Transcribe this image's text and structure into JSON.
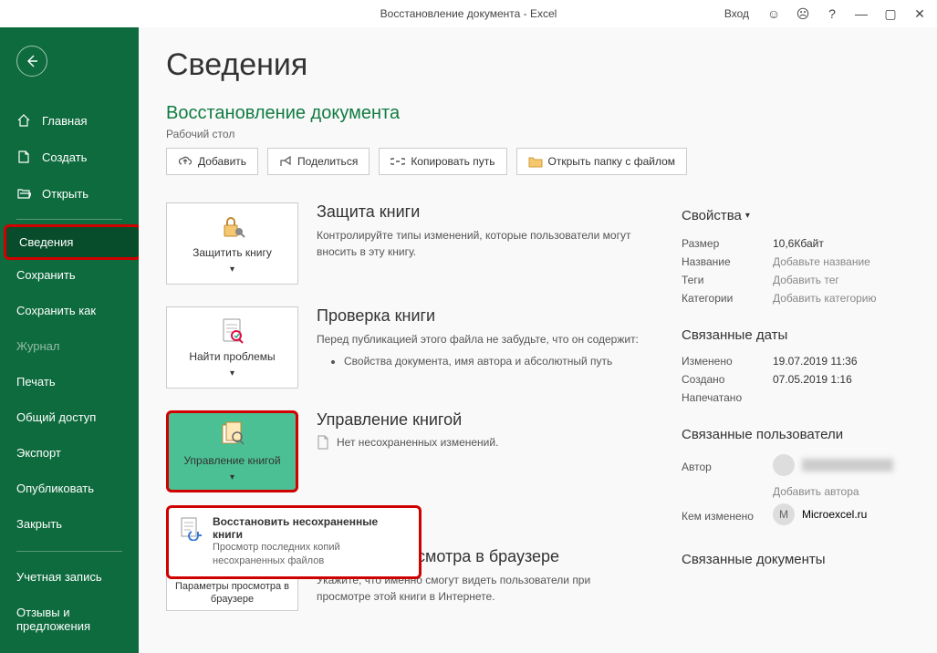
{
  "titlebar": {
    "title": "Восстановление документа  -  Excel",
    "signin": "Вход"
  },
  "nav": {
    "home": "Главная",
    "new": "Создать",
    "open": "Открыть",
    "info": "Сведения",
    "save": "Сохранить",
    "saveas": "Сохранить как",
    "history": "Журнал",
    "print": "Печать",
    "share": "Общий доступ",
    "export": "Экспорт",
    "publish": "Опубликовать",
    "close": "Закрыть",
    "account": "Учетная запись",
    "feedback": "Отзывы и предложения"
  },
  "page": {
    "title": "Сведения",
    "docname": "Восстановление документа",
    "path": "Рабочий стол",
    "toolbar": {
      "upload": "Добавить",
      "share": "Поделиться",
      "copypath": "Копировать путь",
      "openfolder": "Открыть папку с файлом"
    },
    "protect": {
      "btn": "Защитить книгу",
      "heading": "Защита книги",
      "desc": "Контролируйте типы изменений, которые пользователи могут вносить в эту книгу."
    },
    "inspect": {
      "btn": "Найти проблемы",
      "heading": "Проверка книги",
      "desc": "Перед публикацией этого файла не забудьте, что он содержит:",
      "bullet": "Свойства документа, имя автора и абсолютный путь"
    },
    "manage": {
      "btn": "Управление книгой",
      "heading": "Управление книгой",
      "desc": "Нет несохраненных изменений."
    },
    "recover": {
      "title": "Восстановить несохраненные книги",
      "desc": "Просмотр последних копий несохраненных файлов"
    },
    "browser": {
      "btn": "Параметры просмотра в браузере",
      "heading_suffix": "осмотра в браузере",
      "desc": "Укажите, что именно смогут видеть пользователи при просмотре этой книги в Интернете."
    }
  },
  "props": {
    "heading": "Свойства",
    "size_l": "Размер",
    "size_v": "10,6Кбайт",
    "title_l": "Название",
    "title_v": "Добавьте название",
    "tags_l": "Теги",
    "tags_v": "Добавить тег",
    "cat_l": "Категории",
    "cat_v": "Добавить категорию",
    "dates_h": "Связанные даты",
    "modified_l": "Изменено",
    "modified_v": "19.07.2019 11:36",
    "created_l": "Создано",
    "created_v": "07.05.2019 1:16",
    "printed_l": "Напечатано",
    "people_h": "Связанные пользователи",
    "author_l": "Автор",
    "add_author": "Добавить автора",
    "lastmod_l": "Кем изменено",
    "lastmod_v": "Microexcel.ru",
    "docs_h": "Связанные документы"
  }
}
